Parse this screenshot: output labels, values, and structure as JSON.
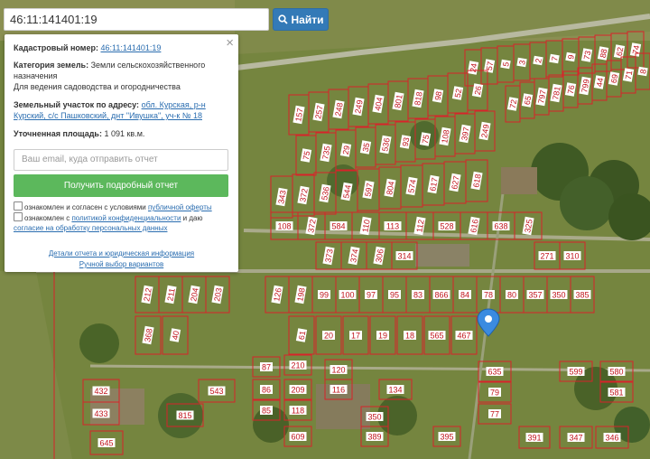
{
  "search": {
    "value": "46:11:141401:19",
    "button_label": "Найти"
  },
  "panel": {
    "cadastral_label": "Кадастровый номер:",
    "cadastral_value": "46:11:141401:19",
    "category_label": "Категория земель:",
    "category_value": "Земли сельскохозяйственного назначения",
    "usage": "Для ведения садоводства и огородничества",
    "address_label": "Земельный участок по адресу:",
    "address_value": "обл. Курская, р-н Курский, с/с Пашковский, днт \"Ивушка\", уч-к № 18",
    "area_label": "Уточненная площадь:",
    "area_value": "1 091 кв.м.",
    "email_placeholder": "Ваш email, куда отправить отчет",
    "report_button": "Получить подробный отчет",
    "consent1_pre": "ознакомлен и согласен с условиями",
    "consent1_link": "публичной оферты",
    "consent2_pre": "ознакомлен с",
    "consent2_link": "политикой конфиденциальности",
    "consent2_mid": "и даю",
    "consent2_link2": "согласие на обработку персональных данных",
    "link_details": "Детали отчета и юридическая информация",
    "link_manual": "Ручной выбор вариантов",
    "close_symbol": "×"
  },
  "colors": {
    "parcel_border": "#d8232a",
    "label_bg": "#ffffff",
    "label_text": "#c0141c",
    "button_blue": "#337ab7",
    "button_green": "#5cb85c",
    "marker": "#3b8be0"
  },
  "parcels": {
    "road_top": [
      "24",
      "57",
      "5",
      "3",
      "2",
      "7",
      "9",
      "73",
      "88",
      "62",
      "74",
      "72",
      "65",
      "797",
      "781",
      "76",
      "799",
      "44",
      "69",
      "71",
      "8"
    ],
    "upper_rows": [
      "157",
      "257",
      "248",
      "249",
      "404",
      "801",
      "818",
      "98",
      "52",
      "26",
      "75",
      "735",
      "29",
      "35",
      "536",
      "93",
      "75",
      "108",
      "397",
      "249",
      "343",
      "372",
      "536",
      "544",
      "597",
      "804",
      "574",
      "617",
      "627",
      "618",
      "108",
      "372",
      "584",
      "110",
      "113",
      "112",
      "528",
      "616",
      "638",
      "325"
    ],
    "middle_rows": [
      "373",
      "374",
      "306",
      "314",
      "271",
      "310",
      "212",
      "211",
      "204",
      "203",
      "126",
      "198",
      "99",
      "100",
      "97",
      "95",
      "83",
      "866",
      "84",
      "78",
      "80",
      "357",
      "350",
      "385",
      "368",
      "40",
      "61",
      "20",
      "17",
      "19",
      "18",
      "565",
      "467"
    ],
    "lower_rows": [
      "87",
      "210",
      "120",
      "635",
      "599",
      "580",
      "86",
      "209",
      "116",
      "134",
      "79",
      "581",
      "432",
      "543",
      "85",
      "118",
      "77",
      "433",
      "815",
      "350",
      "609",
      "389",
      "395",
      "391",
      "347",
      "346",
      "645"
    ]
  }
}
